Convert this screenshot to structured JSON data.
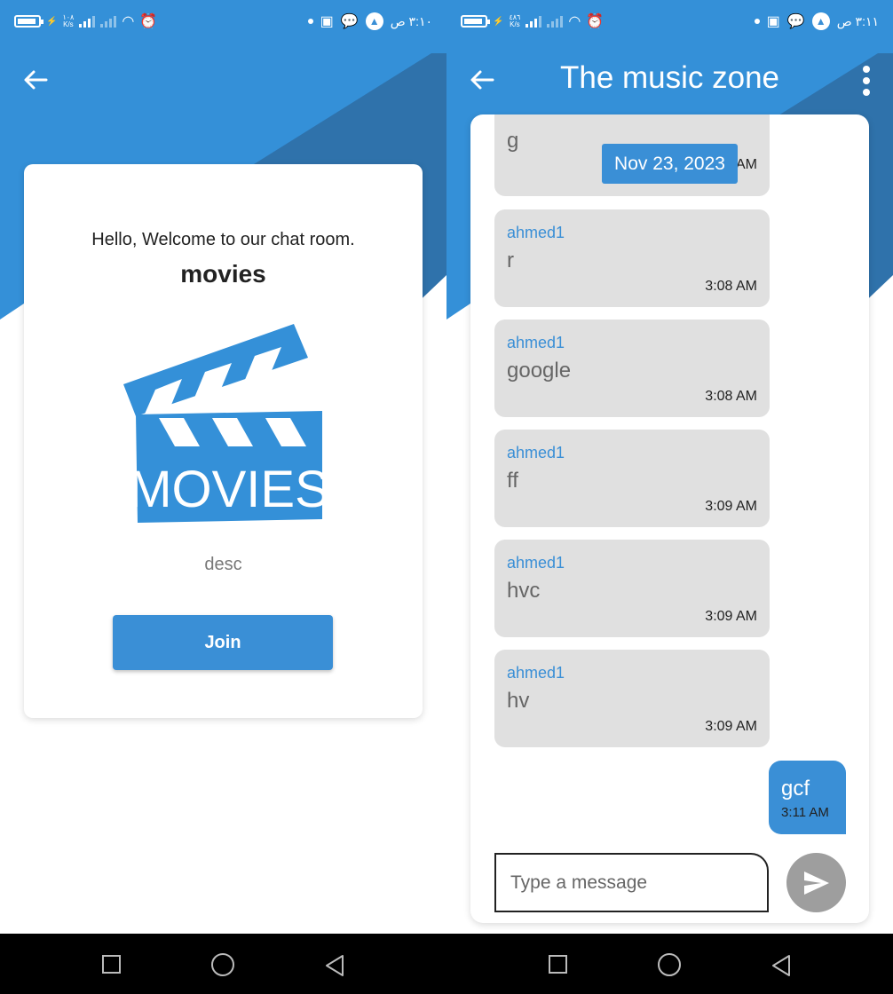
{
  "status_bar_left": {
    "net_speed_top": "١٠٨",
    "net_speed_bottom": "K/s"
  },
  "status_bar_left_2": {
    "net_speed_top": "٤٨٦",
    "net_speed_bottom": "K/s"
  },
  "status_bar_right_left": {
    "time": "٣:١٠ ص"
  },
  "status_bar_right_right": {
    "time": "٣:١١ ص"
  },
  "join_screen": {
    "welcome_text": "Hello, Welcome to our chat room.",
    "room_name": "movies",
    "image_label": "MOVIES",
    "description": "desc",
    "join_label": "Join"
  },
  "chat_screen": {
    "title": "The music zone",
    "date_chip": "Nov 23, 2023",
    "partial_message": {
      "text": "g",
      "time_fragment": "AM"
    },
    "messages": [
      {
        "author": "ahmed1",
        "text": "r",
        "time": "3:08 AM"
      },
      {
        "author": "ahmed1",
        "text": "google",
        "time": "3:08 AM"
      },
      {
        "author": "ahmed1",
        "text": "ff",
        "time": "3:09 AM"
      },
      {
        "author": "ahmed1",
        "text": "hvc",
        "time": "3:09 AM"
      },
      {
        "author": "ahmed1",
        "text": "hv",
        "time": "3:09 AM"
      }
    ],
    "my_message": {
      "text": "gcf",
      "time": "3:11 AM"
    },
    "input_placeholder": "Type a message"
  },
  "colors": {
    "primary": "#3a8fd6",
    "dark_blue": "#2d6fa8",
    "bubble": "#e0e0e0",
    "send": "#9e9e9e"
  }
}
